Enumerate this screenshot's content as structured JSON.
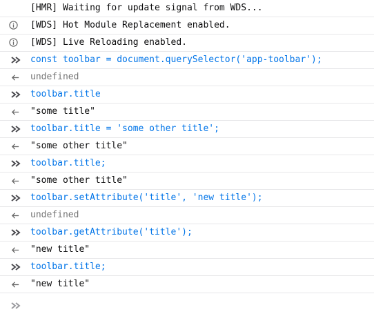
{
  "console": {
    "rows": [
      {
        "kind": "log",
        "text": "[HMR] Waiting for update signal from WDS..."
      },
      {
        "kind": "info",
        "text": "[WDS] Hot Module Replacement enabled."
      },
      {
        "kind": "info",
        "text": "[WDS] Live Reloading enabled."
      },
      {
        "kind": "input",
        "text": "const toolbar = document.querySelector('app-toolbar');"
      },
      {
        "kind": "result-undefined",
        "text": "undefined"
      },
      {
        "kind": "input",
        "text": "toolbar.title"
      },
      {
        "kind": "result",
        "text": "\"some title\""
      },
      {
        "kind": "input",
        "text": "toolbar.title = 'some other title';"
      },
      {
        "kind": "result",
        "text": "\"some other title\""
      },
      {
        "kind": "input",
        "text": "toolbar.title;"
      },
      {
        "kind": "result",
        "text": "\"some other title\""
      },
      {
        "kind": "input",
        "text": "toolbar.setAttribute('title', 'new title');"
      },
      {
        "kind": "result-undefined",
        "text": "undefined"
      },
      {
        "kind": "input",
        "text": "toolbar.getAttribute('title');"
      },
      {
        "kind": "result",
        "text": "\"new title\""
      },
      {
        "kind": "input",
        "text": "toolbar.title;"
      },
      {
        "kind": "result",
        "text": "\"new title\""
      }
    ],
    "prompt_value": ""
  },
  "icons": {
    "info": "info-icon",
    "input": "input-chevrons-icon",
    "result": "result-arrow-icon",
    "prompt": "prompt-chevrons-icon"
  },
  "colors": {
    "input_text": "#0074e8",
    "undefined_text": "#737373",
    "icon_gray": "#6a6a6a",
    "icon_dark": "#4a4a4f",
    "row_border": "#e7e7e9"
  }
}
